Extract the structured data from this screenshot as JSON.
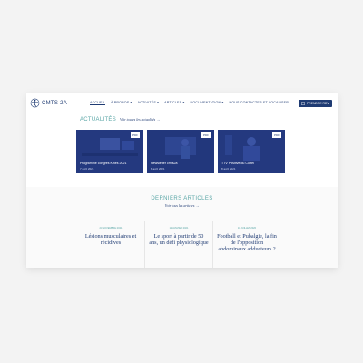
{
  "brand": {
    "name": "CMTS 2A"
  },
  "nav": {
    "items": [
      {
        "label": "ACCUEIL",
        "active": true
      },
      {
        "label": "À PROPOS ▾"
      },
      {
        "label": "ACTIVITÉS ▾"
      },
      {
        "label": "ARTICLES ▾"
      },
      {
        "label": "DOCUMENTATION ▾"
      },
      {
        "label": "NOUS CONTACTER ET LOCALISER"
      }
    ],
    "cta": "PRENDRE RDV"
  },
  "news": {
    "title": "ACTUALITÉS",
    "link": "Voir toutes les actualités →",
    "cards": [
      {
        "badge": "PDF",
        "title": "Programme congrès Kinés 2021",
        "date": "7 avril 2021"
      },
      {
        "badge": "PDF",
        "title": "Newsletter cmts2a",
        "date": "8 avril 2021"
      },
      {
        "badge": "PDF",
        "title": "TTV Positive du Cortel",
        "date": "8 avril 2021"
      }
    ]
  },
  "articles": {
    "title": "DERNIERS ARTICLES",
    "link": "Voir tous les articles →",
    "items": [
      {
        "date": "23 NOVEMBRE 2021",
        "title": "Lésions musculaires et récidives"
      },
      {
        "date": "11 JANVIER 2021",
        "title": "Le sport à partir de 50 ans, un défi physiologique"
      },
      {
        "date": "10 JUILLET 2020",
        "title": "Football et Pubalgie, la fin de l'opposition abdominaux adducteurs ?"
      }
    ]
  },
  "colors": {
    "navy": "#1f3b73",
    "teal": "#5aa6a6",
    "card": "#263f86"
  }
}
